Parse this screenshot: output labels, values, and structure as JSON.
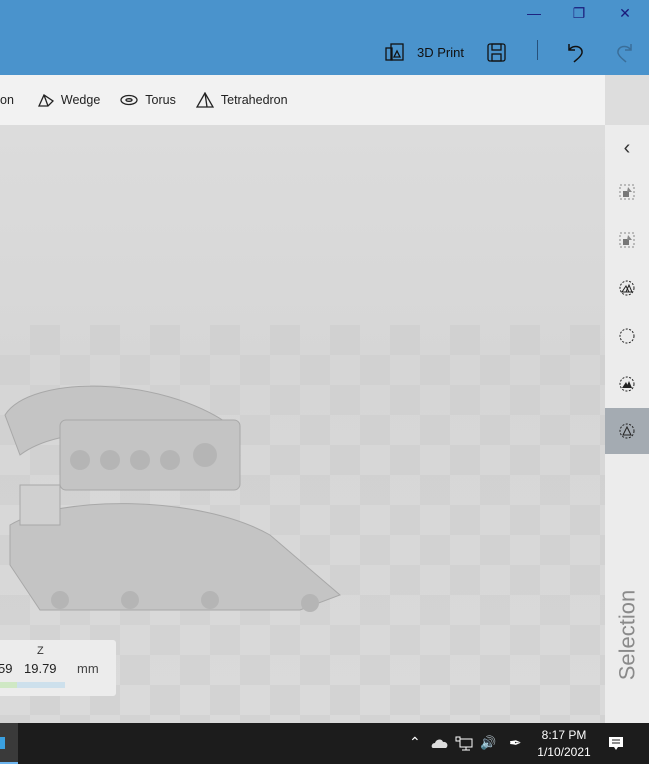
{
  "toolbar": {
    "print_label": "3D Print"
  },
  "shapes": [
    {
      "label": "Wedge"
    },
    {
      "label": "Torus"
    },
    {
      "label": "Tetrahedron"
    }
  ],
  "shapes_partial": "on",
  "side": {
    "selection_label": "Selection"
  },
  "dims": {
    "z_label": "Z",
    "x_partial": "59",
    "z_value": "19.79",
    "unit": "mm"
  },
  "taskbar": {
    "time": "8:17 PM",
    "date": "1/10/2021"
  },
  "colors": {
    "titlebar": "#4a93cc",
    "selected": "#a4abb2"
  }
}
